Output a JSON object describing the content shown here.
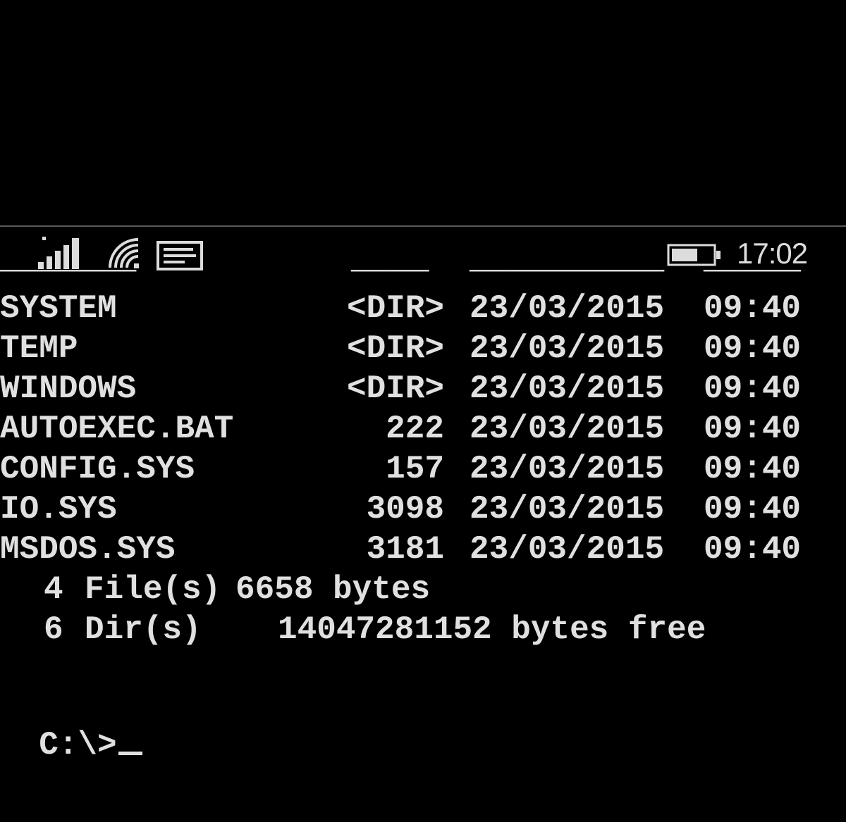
{
  "status_bar": {
    "signal_icon": "signal-bars-icon",
    "wifi_icon": "wifi-icon",
    "message_icon": "message-icon",
    "battery_icon": "battery-icon",
    "time": "17:02"
  },
  "listing": {
    "rows": [
      {
        "name": "SYSTEM",
        "size": "<DIR>",
        "date": "23/03/2015",
        "time": "09:40"
      },
      {
        "name": "TEMP",
        "size": "<DIR>",
        "date": "23/03/2015",
        "time": "09:40"
      },
      {
        "name": "WINDOWS",
        "size": "<DIR>",
        "date": "23/03/2015",
        "time": "09:40"
      },
      {
        "name": "AUTOEXEC.BAT",
        "size": "222",
        "date": "23/03/2015",
        "time": "09:40"
      },
      {
        "name": "CONFIG.SYS",
        "size": "157",
        "date": "23/03/2015",
        "time": "09:40"
      },
      {
        "name": "IO.SYS",
        "size": "3098",
        "date": "23/03/2015",
        "time": "09:40"
      },
      {
        "name": "MSDOS.SYS",
        "size": "3181",
        "date": "23/03/2015",
        "time": "09:40"
      }
    ],
    "files_count": "4",
    "files_label": "File(s)",
    "files_bytes": "6658 bytes",
    "dirs_count": "6",
    "dirs_label": "Dir(s)",
    "dirs_free": "14047281152 bytes free"
  },
  "prompt": "C:\\>"
}
